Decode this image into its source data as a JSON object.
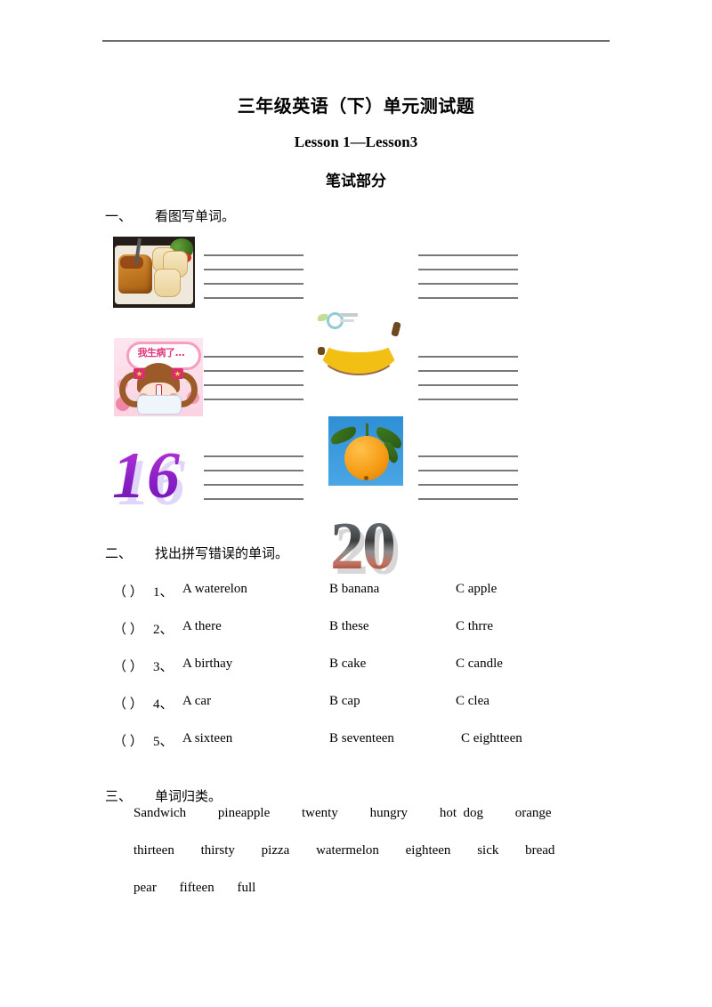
{
  "document": {
    "title_main": "三年级英语（下）单元测试题",
    "title_sub": "Lesson 1—Lesson3",
    "title_part": "笔试部分"
  },
  "sections": [
    {
      "number": "一、",
      "heading": "看图写单词。",
      "rows": [
        {
          "items": [
            {
              "image": "bread-photo",
              "alt": "bread loaf and slices on a plate",
              "lines": 4
            },
            {
              "image": "banana-photo",
              "alt": "yellow banana",
              "watermark": true,
              "lines": 4
            }
          ]
        },
        {
          "items": [
            {
              "image": "sick-girl-cartoon",
              "alt": "cartoon girl wearing face mask",
              "bubble_text": "我生病了...",
              "lines": 4
            },
            {
              "image": "orange-photo",
              "alt": "orange with leaves on blue sky",
              "lines": 4
            }
          ]
        },
        {
          "items": [
            {
              "image": "number-16-wordart",
              "alt": "16",
              "text": "16",
              "lines": 4
            },
            {
              "image": "number-20-wordart",
              "alt": "20",
              "text": "20",
              "lines": 4
            }
          ]
        }
      ]
    },
    {
      "number": "二、",
      "heading": "找出拼写错误的单词。",
      "questions": [
        {
          "paren": "（      ）",
          "num": "1、",
          "a": "A waterelon",
          "b": "B banana",
          "c": "C apple"
        },
        {
          "paren": "（      ）",
          "num": "2、",
          "a": "A there",
          "b": "B these",
          "c": "C thrre"
        },
        {
          "paren": "（      ）",
          "num": "3、",
          "a": "A birthay",
          "b": "B cake",
          "c": "C candle"
        },
        {
          "paren": "（      ）",
          "num": "4、",
          "a": "A car",
          "b": "B cap",
          "c": "C clea"
        },
        {
          "paren": "（      ）",
          "num": "5、",
          "a": "A sixteen",
          "b": "B seventeen",
          "c": "C eightteen"
        }
      ]
    },
    {
      "number": "三、",
      "heading": "单词归类。",
      "word_bank_lines": [
        [
          "Sandwich",
          "pineapple",
          "twenty",
          "hungry",
          "hot  dog",
          "orange"
        ],
        [
          "thirteen",
          "thirsty",
          "pizza",
          "watermelon",
          "eighteen",
          "sick",
          "bread"
        ],
        [
          "pear",
          "fifteen",
          "full"
        ]
      ]
    }
  ]
}
